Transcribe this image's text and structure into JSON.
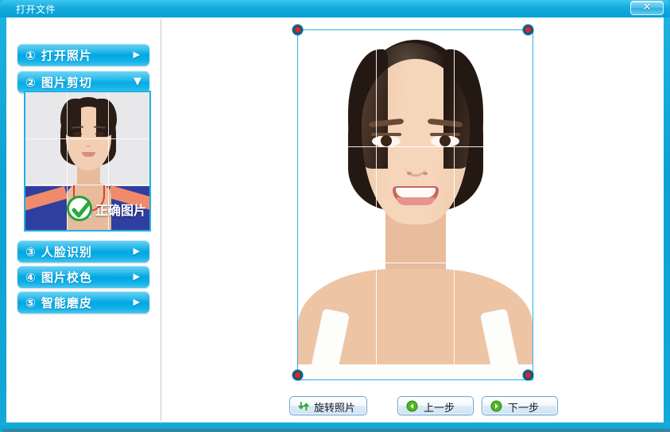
{
  "window": {
    "title": "打开文件",
    "close_label": "✕",
    "accent": "#0aa3d4",
    "title_bar_color": "#14aadd"
  },
  "sidebar": {
    "steps": [
      {
        "number": "①",
        "label": "① 打开照片",
        "chevron": "▶",
        "state": "collapsed"
      },
      {
        "number": "②",
        "label": "② 图片剪切",
        "chevron": "▼",
        "state": "expanded"
      },
      {
        "number": "③",
        "label": "③ 人脸识别",
        "chevron": "▶",
        "state": "collapsed"
      },
      {
        "number": "④",
        "label": "④ 图片校色",
        "chevron": "▶",
        "state": "collapsed"
      },
      {
        "number": "⑤",
        "label": "⑤ 智能磨皮",
        "chevron": "▶",
        "state": "collapsed"
      }
    ],
    "thumbnail": {
      "badge_label": "正确图片",
      "badge_check": "✓",
      "badge_color": "#23a338"
    }
  },
  "canvas": {
    "crop_frame_color": "#29b2e8",
    "handle_color": "#e8211c",
    "handle_border_color": "#0b5c85",
    "grid_color": "#ffffff"
  },
  "footer": {
    "rotate_label": "旋转照片",
    "prev_label": "上一步",
    "next_label": "下一步"
  }
}
